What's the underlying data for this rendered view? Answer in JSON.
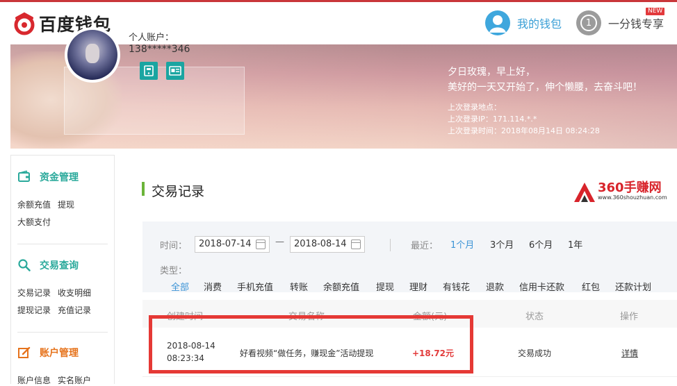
{
  "header": {
    "logo_text": "百度钱包",
    "nav_wallet": "我的钱包",
    "nav_cent": "一分钱专享",
    "nav_cent_number": "1",
    "new_badge": "NEW"
  },
  "banner": {
    "account_label": "个人账户：",
    "account_number": "138*****346",
    "greeting_line1": "夕日玫瑰，早上好，",
    "greeting_line2": "美好的一天又开始了，伸个懒腰，去奋斗吧！",
    "last_login_place": "上次登录地点：",
    "last_login_ip": "上次登录IP：171.114.*.*",
    "last_login_time": "上次登录时间：2018年08月14日 08:24:28"
  },
  "sidebar": {
    "funds": {
      "title": "资金管理",
      "links": [
        "余额充值",
        "提现",
        "大额支付"
      ]
    },
    "query": {
      "title": "交易查询",
      "links": [
        "交易记录",
        "收支明细",
        "提现记录",
        "充值记录"
      ]
    },
    "account": {
      "title": "账户管理",
      "links": [
        "账户信息",
        "实名账户"
      ]
    }
  },
  "main": {
    "title": "交易记录",
    "watermark_brand": "360手赚网",
    "watermark_url": "www.360shouzhuan.com",
    "filter": {
      "time_label": "时间：",
      "date_from": "2018-07-14",
      "date_sep": "—",
      "date_to": "2018-08-14",
      "recent_label": "最近：",
      "recent_options": [
        "1个月",
        "3个月",
        "6个月",
        "1年"
      ],
      "recent_selected": "1个月",
      "type_label": "类型：",
      "types": [
        "全部",
        "消费",
        "手机充值",
        "转账",
        "余额充值",
        "提现",
        "理财",
        "有钱花",
        "退款",
        "信用卡还款",
        "红包",
        "还款计划"
      ],
      "type_selected": "全部"
    },
    "table": {
      "headers": [
        "创建时间",
        "交易名称",
        "金额(元)",
        "状态",
        "操作"
      ],
      "rows": [
        {
          "date": "2018-08-14",
          "time": "08:23:34",
          "name": "好看视频“做任务，赚现金”活动提现",
          "amount": "+18.72元",
          "status": "交易成功",
          "action": "详情"
        }
      ]
    }
  },
  "colors": {
    "brand_red": "#c9363a",
    "accent_teal": "#2aa99b",
    "link_blue": "#3b93d6",
    "amount_red": "#e23b3b",
    "highlight_red": "#e53935"
  }
}
